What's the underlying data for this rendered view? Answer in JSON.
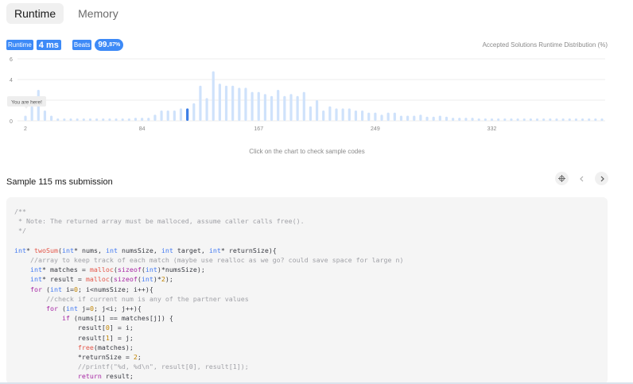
{
  "tabs": [
    {
      "label": "Runtime",
      "active": true
    },
    {
      "label": "Memory",
      "active": false
    }
  ],
  "stats": {
    "runtime_label": "Runtime",
    "runtime_value": "4 ms",
    "beats_label": "Beats",
    "beats_value": "99.",
    "beats_fraction": "87%"
  },
  "distribution_label": "Accepted Solutions Runtime Distribution (%)",
  "tooltip": "You are here!",
  "hint": "Click on the chart to check sample codes",
  "sample_title": "Sample 115 ms submission",
  "colors": {
    "accent": "#3d8af7",
    "bar": "#cfe2fb",
    "bar_active": "#3d7fe6"
  },
  "icons": {
    "code_icon": "crosshair-icon",
    "prev": "chevron-left-icon",
    "next": "chevron-right-icon"
  },
  "chart_data": {
    "type": "bar",
    "y_ticks": [
      0,
      2,
      4,
      6
    ],
    "ylim": [
      0,
      6
    ],
    "x_tick_labels": [
      "2",
      "84",
      "167",
      "249",
      "332"
    ],
    "x_tick_bar_index": [
      0,
      18,
      36,
      54,
      72
    ],
    "grid": true,
    "active_index": 25,
    "values": [
      0.5,
      1.4,
      3.0,
      1.0,
      0.5,
      0.2,
      0.2,
      0.2,
      0.2,
      0.2,
      0.2,
      0.2,
      0.2,
      0.2,
      0.2,
      0.2,
      0.2,
      0.3,
      0.3,
      0.3,
      0.6,
      1.0,
      1.0,
      1.0,
      1.2,
      1.2,
      1.7,
      3.4,
      2.2,
      4.8,
      3.6,
      3.4,
      3.4,
      3.2,
      3.2,
      2.8,
      2.8,
      2.6,
      2.4,
      3.0,
      2.4,
      2.6,
      2.4,
      2.8,
      1.4,
      2.0,
      1.0,
      1.4,
      1.2,
      1.2,
      1.2,
      1.0,
      1.0,
      0.8,
      0.8,
      0.6,
      0.8,
      0.8,
      0.5,
      0.5,
      0.5,
      0.6,
      0.4,
      0.4,
      0.5,
      0.4,
      0.3,
      0.3,
      0.3,
      0.3,
      0.2,
      0.2,
      0.2,
      0.2,
      0.2,
      0.2,
      0.2,
      0.2,
      0.2,
      0.2,
      0.2,
      0.2,
      0.2,
      0.2,
      0.2,
      0.2,
      0.2,
      0.2,
      0.2,
      0.2
    ]
  },
  "code_lines": [
    [
      [
        "cm",
        "/**"
      ]
    ],
    [
      [
        "cm",
        " * Note: The returned array must be malloced, assume caller calls free()."
      ]
    ],
    [
      [
        "cm",
        " */"
      ]
    ],
    [
      [
        "",
        ""
      ]
    ],
    [
      [
        "ty",
        "int"
      ],
      [
        "",
        "* "
      ],
      [
        "fn",
        "twoSum"
      ],
      [
        "",
        "("
      ],
      [
        "ty",
        "int"
      ],
      [
        "",
        "* nums, "
      ],
      [
        "ty",
        "int"
      ],
      [
        "",
        " numsSize, "
      ],
      [
        "ty",
        "int"
      ],
      [
        "",
        " target, "
      ],
      [
        "ty",
        "int"
      ],
      [
        "",
        "* returnSize){"
      ]
    ],
    [
      [
        "cm",
        "    //array to keep track of each match (maybe use realloc as we go? could save space for large n)"
      ]
    ],
    [
      [
        "ty",
        "    int"
      ],
      [
        "",
        "* matches = "
      ],
      [
        "fn",
        "malloc"
      ],
      [
        "",
        "("
      ],
      [
        "kw",
        "sizeof"
      ],
      [
        "",
        "("
      ],
      [
        "ty",
        "int"
      ],
      [
        "",
        ")*numsSize);"
      ]
    ],
    [
      [
        "ty",
        "    int"
      ],
      [
        "",
        "* result = "
      ],
      [
        "fn",
        "malloc"
      ],
      [
        "",
        "("
      ],
      [
        "kw",
        "sizeof"
      ],
      [
        "",
        "("
      ],
      [
        "ty",
        "int"
      ],
      [
        "",
        ")*"
      ],
      [
        "nm",
        "2"
      ],
      [
        "",
        ");"
      ]
    ],
    [
      [
        "kw",
        "    for"
      ],
      [
        "",
        " ("
      ],
      [
        "ty",
        "int"
      ],
      [
        "",
        " i="
      ],
      [
        "nm",
        "0"
      ],
      [
        "",
        "; i<numsSize; i++){"
      ]
    ],
    [
      [
        "cm",
        "        //check if current num is any of the partner values"
      ]
    ],
    [
      [
        "kw",
        "        for"
      ],
      [
        "",
        " ("
      ],
      [
        "ty",
        "int"
      ],
      [
        "",
        " j="
      ],
      [
        "nm",
        "0"
      ],
      [
        "",
        "; j<i; j++){"
      ]
    ],
    [
      [
        "kw",
        "            if"
      ],
      [
        "",
        " (nums[i] == matches[j]) {"
      ]
    ],
    [
      [
        "",
        "                result["
      ],
      [
        "nm",
        "0"
      ],
      [
        "",
        "] = i;"
      ]
    ],
    [
      [
        "",
        "                result["
      ],
      [
        "nm",
        "1"
      ],
      [
        "",
        "] = j;"
      ]
    ],
    [
      [
        "fn",
        "                free"
      ],
      [
        "",
        "(matches);"
      ]
    ],
    [
      [
        "",
        "                *returnSize = "
      ],
      [
        "nm",
        "2"
      ],
      [
        "",
        ";"
      ]
    ],
    [
      [
        "cm",
        "                //printf(\"%d, %d\\n\", result[0], result[1]);"
      ]
    ],
    [
      [
        "kw",
        "                return"
      ],
      [
        "",
        " result;"
      ]
    ]
  ]
}
